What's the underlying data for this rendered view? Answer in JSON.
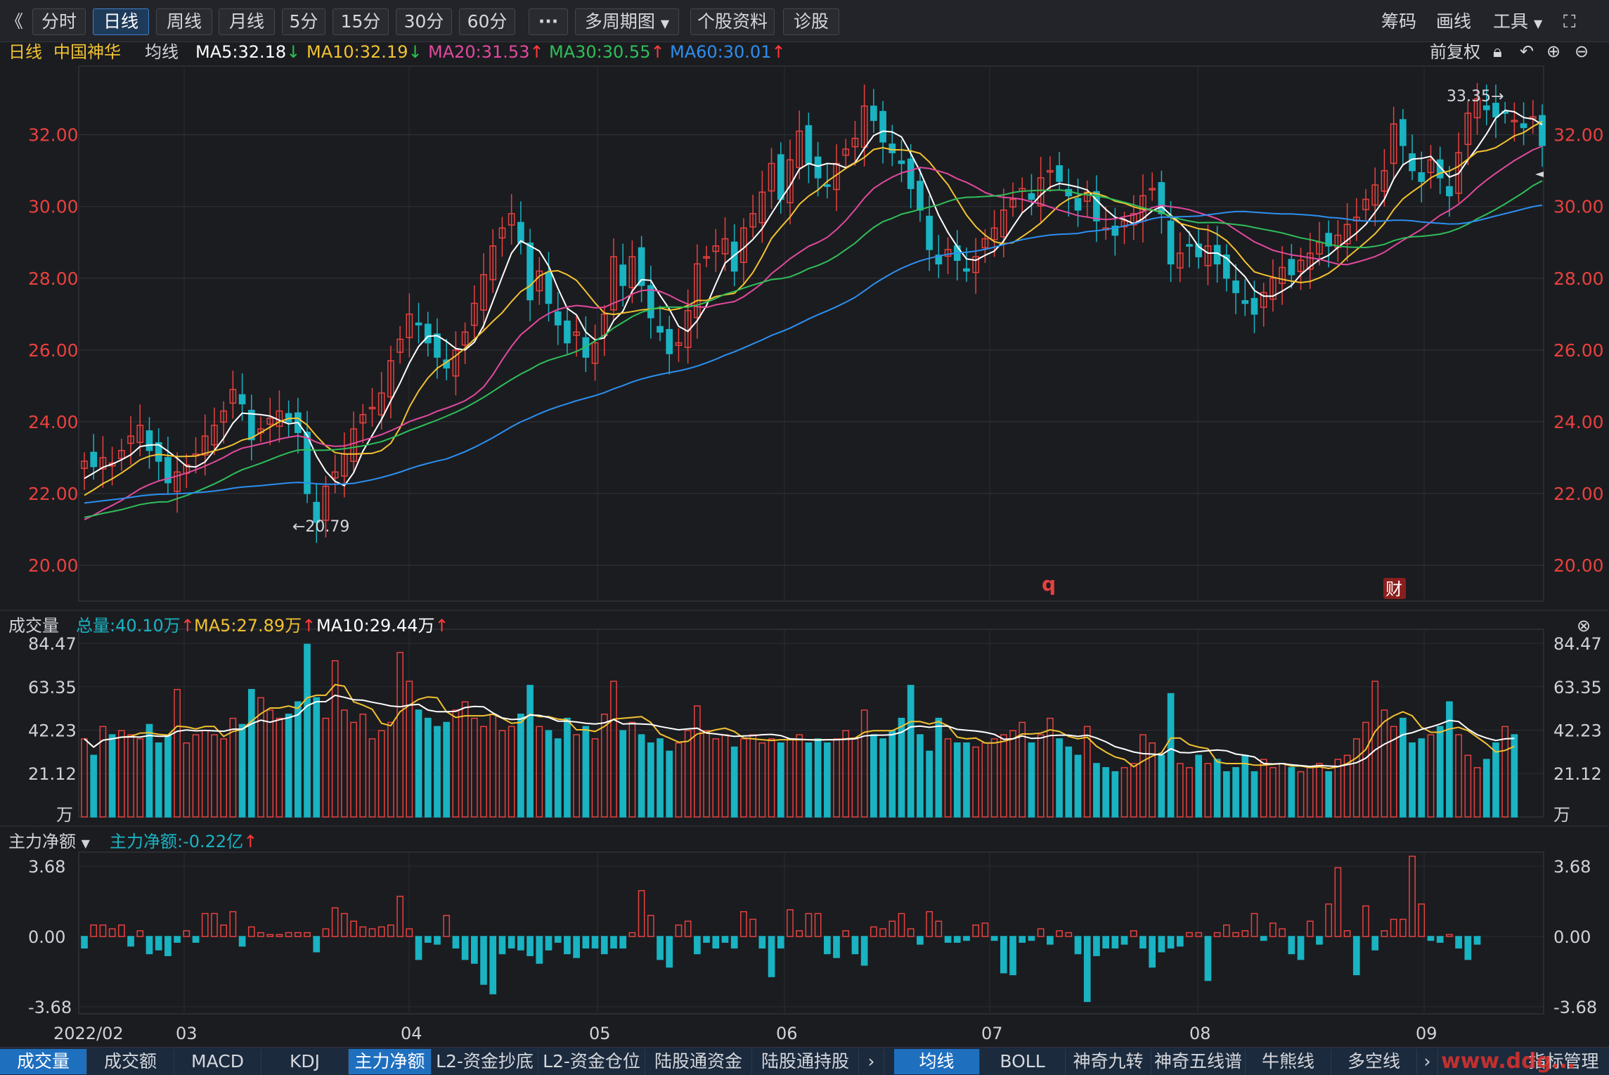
{
  "toolbar": {
    "back_icon": "double-chevron-left-icon",
    "periods": [
      "分时",
      "日线",
      "周线",
      "月线",
      "5分",
      "15分",
      "30分",
      "60分"
    ],
    "active_period": "日线",
    "more_label": "···",
    "multi_period": "多周期图",
    "stock_info": "个股资料",
    "diagnose": "诊股",
    "chips": "筹码",
    "draw": "画线",
    "tools": "工具",
    "fullscreen_icon": "expand-icon"
  },
  "indicator_bar": {
    "period": "日线",
    "stock_name": "中国神华",
    "ma_label": "均线",
    "ma5": "MA5:32.18",
    "ma10": "MA10:32.19",
    "ma20": "MA20:31.53",
    "ma30": "MA30:30.55",
    "ma60": "MA60:30.01",
    "adjust": "前复权"
  },
  "colors": {
    "up": "#e8413e",
    "down": "#19b3c2",
    "ma5": "#ffffff",
    "ma10": "#f2c230",
    "ma20": "#e2499e",
    "ma30": "#2fbf5a",
    "ma60": "#2c8ff0"
  },
  "price_panel": {
    "y_ticks": [
      "32.00",
      "30.00",
      "28.00",
      "26.00",
      "24.00",
      "22.00",
      "20.00"
    ],
    "high_label": "33.35→",
    "low_label": "←20.79",
    "event_q": "q",
    "event_cai": "财"
  },
  "volume_panel": {
    "title": "成交量",
    "total": "总量:40.10万",
    "ma5": "MA5:27.89万",
    "ma10": "MA10:29.44万",
    "y_ticks": [
      "84.47",
      "63.35",
      "42.23",
      "21.12",
      "万"
    ]
  },
  "flow_panel": {
    "title": "主力净额",
    "value": "主力净额:-0.22亿",
    "y_ticks": [
      "3.68",
      "0.00",
      "-3.68"
    ]
  },
  "x_axis": {
    "labels": [
      "2022/02",
      "03",
      "04",
      "05",
      "06",
      "07",
      "08",
      "09"
    ]
  },
  "bottom_tabs": {
    "left": [
      "成交量",
      "成交额",
      "MACD",
      "KDJ",
      "主力净额",
      "L2-资金抄底",
      "L2-资金仓位",
      "陆股通资金",
      "陆股通持股"
    ],
    "right": [
      "均线",
      "BOLL",
      "神奇九转",
      "神奇五线谱",
      "牛熊线",
      "多空线"
    ],
    "manage": "指标管理",
    "watermark": "www.ddg..."
  },
  "chart_data": {
    "type": "candlestick",
    "title": "中国神华",
    "y_range": [
      19.0,
      33.6
    ],
    "closes": [
      22.9,
      22.75,
      23.0,
      22.85,
      23.2,
      23.6,
      23.9,
      23.2,
      22.9,
      22.3,
      22.6,
      22.8,
      23.1,
      23.6,
      23.9,
      24.3,
      24.9,
      24.5,
      23.5,
      23.8,
      24.1,
      24.3,
      24.0,
      23.7,
      22.0,
      21.2,
      22.2,
      22.6,
      23.1,
      23.8,
      24.2,
      24.4,
      24.8,
      25.7,
      26.3,
      27.0,
      26.7,
      26.2,
      25.8,
      25.5,
      26.0,
      26.5,
      27.3,
      28.1,
      28.9,
      29.4,
      29.8,
      29.0,
      27.4,
      28.2,
      27.3,
      26.7,
      26.2,
      26.5,
      25.8,
      26.2,
      27.0,
      28.6,
      27.8,
      28.6,
      27.8,
      26.9,
      26.5,
      25.9,
      26.2,
      27.1,
      28.4,
      28.6,
      28.9,
      29.1,
      28.2,
      29.4,
      29.8,
      30.4,
      31.2,
      30.2,
      31.3,
      32.1,
      31.2,
      30.8,
      30.6,
      31.2,
      31.6,
      31.9,
      32.8,
      32.4,
      31.8,
      31.5,
      31.2,
      30.5,
      29.9,
      28.8,
      28.4,
      28.8,
      28.5,
      28.2,
      28.6,
      29.1,
      29.4,
      29.9,
      30.2,
      30.5,
      30.2,
      30.8,
      31.0,
      30.7,
      30.3,
      29.9,
      30.4,
      29.6,
      29.4,
      29.2,
      29.6,
      29.8,
      30.3,
      30.5,
      29.8,
      28.4,
      28.7,
      28.9,
      28.6,
      28.9,
      28.4,
      28.0,
      27.6,
      27.3,
      27.0,
      27.6,
      28.0,
      28.3,
      28.1,
      28.5,
      28.7,
      29.0,
      28.9,
      29.2,
      29.5,
      29.7,
      30.2,
      30.6,
      31.0,
      32.3,
      31.7,
      31.0,
      30.7,
      31.3,
      30.8,
      30.3,
      31.5,
      32.6,
      33.0,
      32.7,
      32.5,
      32.6,
      32.4,
      32.2,
      32.5,
      31.7
    ],
    "ma_lines": [
      "MA5",
      "MA10",
      "MA20",
      "MA30",
      "MA60"
    ],
    "volume_unit": "万",
    "volume_range": [
      0,
      84.47
    ],
    "volumes": [
      38,
      30,
      44,
      40,
      42,
      40,
      38,
      45,
      36,
      40,
      62,
      36,
      40,
      42,
      40,
      38,
      48,
      45,
      62,
      58,
      52,
      48,
      50,
      56,
      84,
      58,
      48,
      76,
      52,
      46,
      50,
      38,
      42,
      46,
      80,
      66,
      52,
      48,
      44,
      46,
      52,
      56,
      48,
      44,
      50,
      42,
      44,
      50,
      64,
      44,
      42,
      38,
      48,
      40,
      44,
      38,
      50,
      66,
      42,
      46,
      40,
      36,
      38,
      32,
      36,
      42,
      54,
      42,
      38,
      40,
      34,
      38,
      40,
      36,
      38,
      36,
      38,
      40,
      36,
      38,
      36,
      38,
      42,
      38,
      52,
      40,
      38,
      42,
      48,
      64,
      40,
      32,
      48,
      38,
      36,
      36,
      34,
      36,
      38,
      40,
      42,
      46,
      36,
      40,
      48,
      38,
      34,
      30,
      44,
      26,
      24,
      22,
      24,
      26,
      40,
      36,
      30,
      60,
      26,
      24,
      30,
      26,
      28,
      22,
      24,
      30,
      22,
      28,
      24,
      26,
      24,
      22,
      24,
      26,
      22,
      28,
      30,
      38,
      46,
      66,
      52,
      44,
      48,
      36,
      38,
      40,
      44,
      56,
      40,
      30,
      24,
      28,
      36,
      44,
      40
    ],
    "net_flow_unit": "亿",
    "net_flow_range": [
      -3.68,
      3.68
    ],
    "net_flow": [
      -0.6,
      0.6,
      0.6,
      0.4,
      0.6,
      -0.5,
      0.3,
      -0.9,
      -0.7,
      -1.0,
      -0.3,
      0.3,
      -0.3,
      1.2,
      1.2,
      0.6,
      1.3,
      -0.5,
      0.5,
      0.2,
      0.1,
      0.1,
      0.2,
      0.2,
      0.2,
      -0.8,
      0.4,
      1.5,
      1.2,
      0.8,
      0.5,
      0.4,
      0.5,
      0.6,
      2.1,
      0.4,
      -1.2,
      -0.3,
      -0.4,
      1.1,
      -0.6,
      -1.2,
      -1.4,
      -2.5,
      -3.0,
      -0.9,
      -0.6,
      -0.7,
      -1.0,
      -1.4,
      -0.7,
      -0.3,
      -0.9,
      -1.1,
      -0.6,
      -0.6,
      -0.9,
      -0.6,
      -0.6,
      0.2,
      2.4,
      1.1,
      -1.2,
      -1.6,
      0.6,
      0.8,
      -0.9,
      -0.3,
      -0.6,
      -0.3,
      -0.6,
      1.3,
      0.9,
      -0.6,
      -2.1,
      -0.6,
      1.4,
      0.3,
      1.2,
      1.2,
      -0.9,
      -1.1,
      0.3,
      -0.9,
      -1.5,
      0.5,
      0.4,
      0.8,
      1.2,
      0.4,
      -0.4,
      1.3,
      0.8,
      -0.3,
      -0.3,
      -0.2,
      0.6,
      0.7,
      -0.2,
      -1.9,
      -2.0,
      -0.3,
      -0.2,
      0.4,
      -0.4,
      0.3,
      0.2,
      -0.9,
      -3.4,
      -1.0,
      -0.6,
      -0.6,
      -0.4,
      0.3,
      -0.6,
      -1.6,
      -0.8,
      -0.6,
      -0.5,
      0.2,
      0.2,
      -2.3,
      0.2,
      0.6,
      0.2,
      0.3,
      1.2,
      -0.2,
      0.7,
      0.4,
      -0.9,
      -1.2,
      0.8,
      -0.4,
      1.7,
      3.6,
      0.3,
      -2.0,
      1.6,
      -0.7,
      0.3,
      0.9,
      0.9,
      4.2,
      1.7,
      -0.2,
      -0.3,
      0.1,
      -0.6,
      -1.2,
      -0.4
    ]
  }
}
